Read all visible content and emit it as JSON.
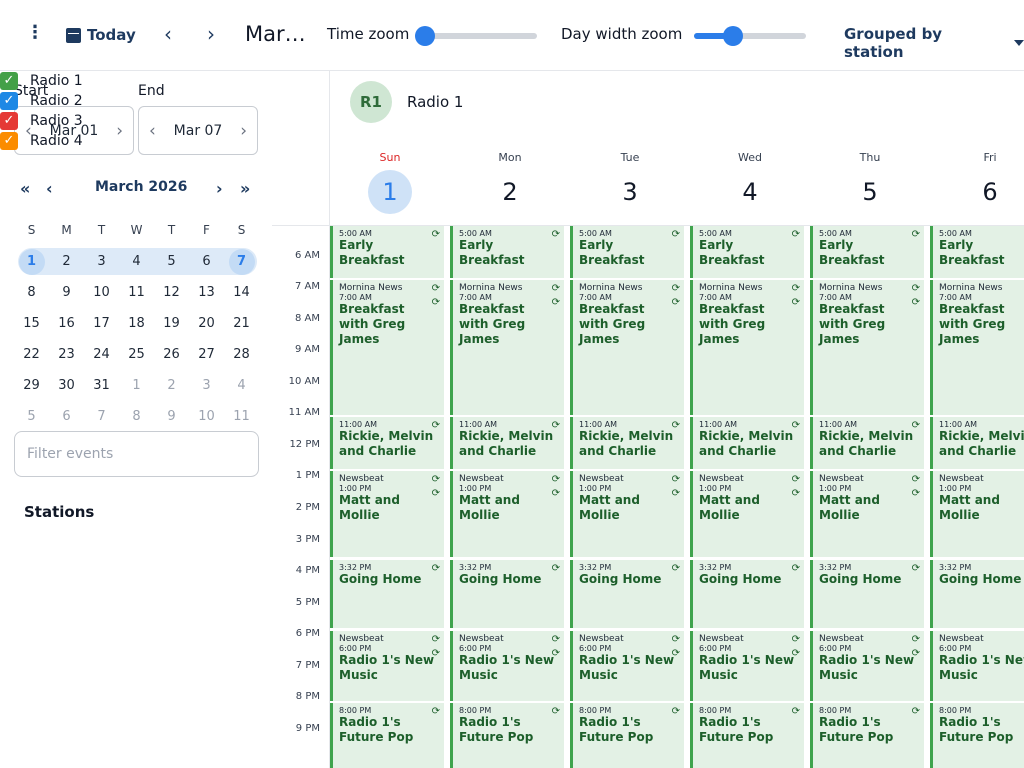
{
  "toolbar": {
    "menu_icon": "kebab-icon",
    "today_label": "Today",
    "prev": "‹",
    "next": "›",
    "month_title": "Mar…",
    "time_zoom_label": "Time zoom",
    "time_zoom_value": 0.0,
    "day_width_zoom_label": "Day width zoom",
    "day_width_zoom_value": 0.35,
    "group_label": "Grouped by station"
  },
  "range": {
    "start_label": "Start",
    "start_value": "Mar 01",
    "end_label": "End",
    "end_value": "Mar 07"
  },
  "mini_calendar": {
    "title": "March 2026",
    "weekdays": [
      "S",
      "M",
      "T",
      "W",
      "T",
      "F",
      "S"
    ],
    "weeks": [
      [
        "1",
        "2",
        "3",
        "4",
        "5",
        "6",
        "7"
      ],
      [
        "8",
        "9",
        "10",
        "11",
        "12",
        "13",
        "14"
      ],
      [
        "15",
        "16",
        "17",
        "18",
        "19",
        "20",
        "21"
      ],
      [
        "22",
        "23",
        "24",
        "25",
        "26",
        "27",
        "28"
      ],
      [
        "29",
        "30",
        "31",
        "1",
        "2",
        "3",
        "4"
      ],
      [
        "5",
        "6",
        "7",
        "8",
        "9",
        "10",
        "11"
      ]
    ]
  },
  "filter": {
    "placeholder": "Filter events"
  },
  "stations": {
    "heading": "Stations",
    "items": [
      {
        "label": "Radio 1",
        "color": "#43a047"
      },
      {
        "label": "Radio 2",
        "color": "#1e88e5"
      },
      {
        "label": "Radio 3",
        "color": "#e53935"
      },
      {
        "label": "Radio 4",
        "color": "#fb8c00"
      }
    ]
  },
  "calendar": {
    "station_avatar": "R1",
    "station_name": "Radio 1",
    "days": [
      {
        "name": "Sun",
        "date": "1",
        "today": true
      },
      {
        "name": "Mon",
        "date": "2"
      },
      {
        "name": "Tue",
        "date": "3"
      },
      {
        "name": "Wed",
        "date": "4"
      },
      {
        "name": "Thu",
        "date": "5"
      },
      {
        "name": "Fri",
        "date": "6"
      }
    ],
    "hours": [
      "6 AM",
      "7 AM",
      "8 AM",
      "9 AM",
      "10 AM",
      "11 AM",
      "12 PM",
      "1 PM",
      "2 PM",
      "3 PM",
      "4 PM",
      "5 PM",
      "6 PM",
      "7 PM",
      "8 PM",
      "9 PM"
    ],
    "events": [
      {
        "time": "5:00 AM",
        "title": "Early Breakfast"
      },
      {
        "sub": "Mornina News",
        "time": "7:00 AM",
        "title": "Breakfast with Greg James"
      },
      {
        "time": "11:00 AM",
        "title": "Rickie, Melvin and Charlie"
      },
      {
        "sub": "Newsbeat",
        "time": "1:00 PM",
        "title": "Matt and Mollie"
      },
      {
        "time": "3:32 PM",
        "title": "Going Home"
      },
      {
        "sub": "Newsbeat",
        "time": "6:00 PM",
        "title": "Radio 1's New Music"
      },
      {
        "time": "8:00 PM",
        "title": "Radio 1's Future Pop"
      }
    ],
    "repeat_icon": "refresh-icon"
  }
}
